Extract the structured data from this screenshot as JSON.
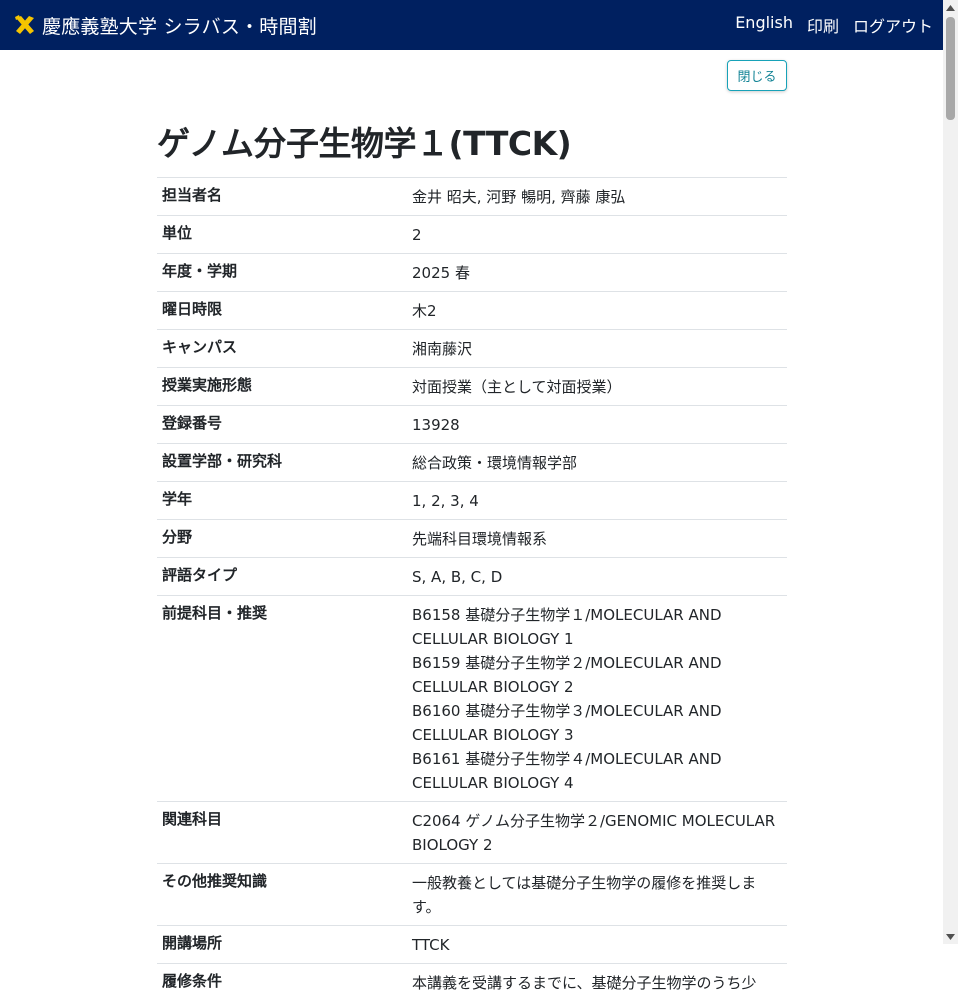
{
  "header": {
    "brand_title": "慶應義塾大学 シラバス・時間割",
    "nav": [
      "English",
      "印刷",
      "ログアウト"
    ],
    "accent_color": "#002060",
    "logo_color": "#f5c400"
  },
  "close_button_label": "閉じる",
  "course_title": "ゲノム分子生物学１(TTCK)",
  "rows": [
    {
      "label": "担当者名",
      "value": [
        "金井 昭夫, 河野 暢明, 齊藤 康弘"
      ]
    },
    {
      "label": "単位",
      "value": [
        "2"
      ]
    },
    {
      "label": "年度・学期",
      "value": [
        "2025 春"
      ]
    },
    {
      "label": "曜日時限",
      "value": [
        "木2"
      ]
    },
    {
      "label": "キャンパス",
      "value": [
        "湘南藤沢"
      ]
    },
    {
      "label": "授業実施形態",
      "value": [
        "対面授業（主として対面授業）"
      ]
    },
    {
      "label": "登録番号",
      "value": [
        "13928"
      ]
    },
    {
      "label": "設置学部・研究科",
      "value": [
        "総合政策・環境情報学部"
      ]
    },
    {
      "label": "学年",
      "value": [
        "1, 2, 3, 4"
      ]
    },
    {
      "label": "分野",
      "value": [
        "先端科目環境情報系"
      ]
    },
    {
      "label": "評語タイプ",
      "value": [
        "S, A, B, C, D"
      ]
    },
    {
      "label": "前提科目・推奨",
      "value": [
        "B6158 基礎分子生物学１/MOLECULAR AND",
        "CELLULAR BIOLOGY 1",
        "B6159 基礎分子生物学２/MOLECULAR AND",
        "CELLULAR BIOLOGY 2",
        "B6160 基礎分子生物学３/MOLECULAR AND",
        "CELLULAR BIOLOGY 3",
        "B6161 基礎分子生物学４/MOLECULAR AND",
        "CELLULAR BIOLOGY 4"
      ]
    },
    {
      "label": "関連科目",
      "value": [
        "C2064 ゲノム分子生物学２/GENOMIC MOLECULAR",
        "BIOLOGY 2"
      ]
    },
    {
      "label": "その他推奨知識",
      "value": [
        "一般教養としては基礎分子生物学の履修を推奨しま",
        "す。"
      ]
    },
    {
      "label": "開講場所",
      "value": [
        "TTCK"
      ]
    },
    {
      "label": "履修条件",
      "value": [
        "本講義を受講するまでに、基礎分子生物学のうち少"
      ]
    }
  ]
}
